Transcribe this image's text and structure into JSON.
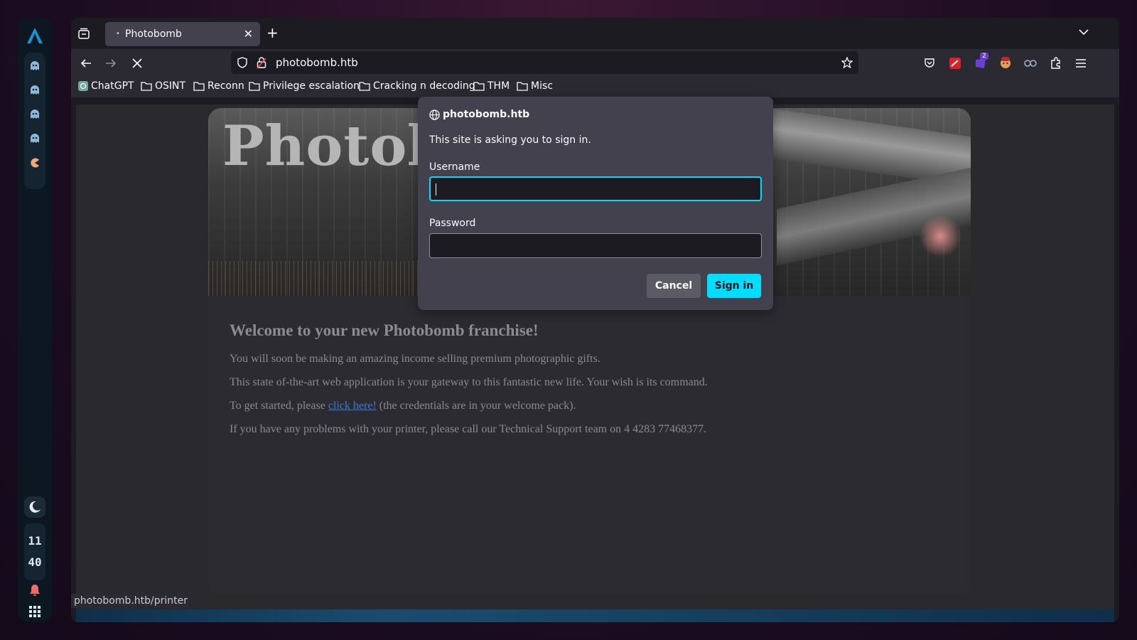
{
  "tab": {
    "title": "Photobomb"
  },
  "navbar": {
    "url": "photobomb.htb"
  },
  "bookmarks": [
    {
      "label": "ChatGPT",
      "icon": "chatgpt-icon"
    },
    {
      "label": "OSINT",
      "icon": "folder-icon"
    },
    {
      "label": "Reconn",
      "icon": "folder-icon"
    },
    {
      "label": "Privilege escalation",
      "icon": "folder-icon"
    },
    {
      "label": "Cracking n decoding",
      "icon": "folder-icon"
    },
    {
      "label": "THM",
      "icon": "folder-icon"
    },
    {
      "label": "Misc",
      "icon": "folder-icon"
    }
  ],
  "page": {
    "brand": "Photobomb",
    "heading": "Welcome to your new Photobomb franchise!",
    "p1": "You will soon be making an amazing income selling premium photographic gifts.",
    "p2": "This state of-the-art web application is your gateway to this fantastic new life. Your wish is its command.",
    "p3_before": "To get started, please",
    "p3_link": "click here!",
    "p3_after": "(the credentials are in your welcome pack).",
    "p4": "If you have any problems with your printer, please call our Technical Support team on 4 4283 77468377."
  },
  "status_url": "photobomb.htb/printer",
  "dialog": {
    "host": "photobomb.htb",
    "message": "This site is asking you to sign in.",
    "username_label": "Username",
    "username_value": "",
    "password_label": "Password",
    "password_value": "",
    "cancel_label": "Cancel",
    "signin_label": "Sign in"
  },
  "dock": {
    "clock_hour": "11",
    "clock_minute": "40"
  },
  "extensions": {
    "badge": "2"
  },
  "colors": {
    "accent": "#00ddff",
    "dialog_bg": "#42414d",
    "toolbar_bg": "#2b2a33"
  }
}
